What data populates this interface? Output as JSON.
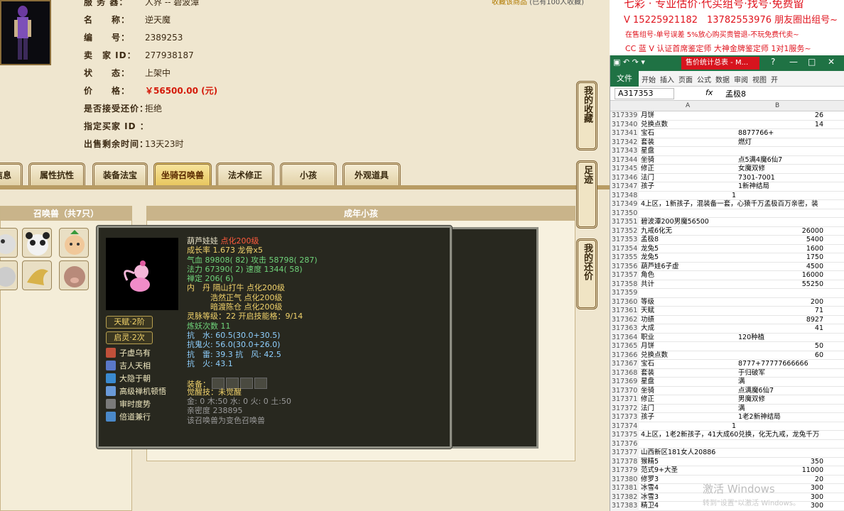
{
  "game": {
    "fav_link": "收藏该商品",
    "fav_count": "(已有100人收藏)",
    "info": [
      {
        "label": "服 务 器：",
        "value": "人界 -- 碧波潭"
      },
      {
        "label": "名　　称：",
        "value": "逆天魔"
      },
      {
        "label": "编　　号：",
        "value": "2389253"
      },
      {
        "label": "卖　家 ID：",
        "value": "277938187"
      },
      {
        "label": "状　　态：",
        "value": "上架中"
      },
      {
        "label": "价　　格：",
        "value": "￥56500.00 (元)"
      },
      {
        "label": "是否接受还价：",
        "value": "拒绝"
      },
      {
        "label": "指定买家 ID ：",
        "value": ""
      },
      {
        "label": "出售剩余时间：",
        "value": "13天23时"
      }
    ],
    "tabs": [
      "信息",
      "属性抗性",
      "装备法宝",
      "坐骑召唤兽",
      "法术修正",
      "小孩",
      "外观道具"
    ],
    "active_tab": "坐骑召唤兽",
    "summon_title": "召唤兽（共7只）",
    "adult_title": "成年小孩",
    "side_buttons": [
      "我的收藏",
      "足迹",
      "我的还价"
    ]
  },
  "tooltip": {
    "name": "葫芦娃娃",
    "name_suffix": "点化200级",
    "lines": [
      {
        "text": "成长率 1.673 龙骨x5",
        "cls": "y"
      },
      {
        "text": "气血 89808( 82) 攻击 58798( 287)",
        "cls": "g"
      },
      {
        "text": "法力 67390( 2) 速度 1344( 58)",
        "cls": "g"
      },
      {
        "text": "禅定 206( 6)",
        "cls": "g"
      },
      {
        "text": "内　丹 隔山打牛 点化200级",
        "cls": "y"
      },
      {
        "text": "　　　浩然正气 点化200级",
        "cls": "y"
      },
      {
        "text": "　　　暗渡陈仓 点化200级",
        "cls": "y"
      },
      {
        "text": "灵脉等级：22 开启技能格：9/14",
        "cls": "y"
      },
      {
        "text": "炼妖次数 11",
        "cls": "g"
      },
      {
        "text": "抗　水: 60.5(30.0+30.5)",
        "cls": "b"
      },
      {
        "text": "抗鬼火: 56.0(30.0+26.0)",
        "cls": "b"
      },
      {
        "text": "抗　雷: 39.3 抗　风: 42.5",
        "cls": "b"
      },
      {
        "text": "抗　火: 43.1",
        "cls": "b"
      },
      {
        "text": "",
        "cls": "w"
      },
      {
        "text": "装备：",
        "cls": "y"
      },
      {
        "text": "觉醒技：未觉醒",
        "cls": "y"
      },
      {
        "text": "金: 0 木:50 水: 0 火: 0 土:50",
        "cls": "gr"
      },
      {
        "text": "亲密度 238895",
        "cls": "gr"
      },
      {
        "text": "该召唤兽为变色召唤兽",
        "cls": "gr"
      }
    ],
    "badges": [
      "天赋·2阶",
      "启灵·2次"
    ],
    "skills": [
      {
        "name": "子虚乌有",
        "color": "#c0503a"
      },
      {
        "name": "吉人天相",
        "color": "#5a78c8"
      },
      {
        "name": "大隐于朝",
        "color": "#3a8ad0"
      },
      {
        "name": "高级禅机顿悟",
        "color": "#6a9ad8"
      },
      {
        "name": "审时度势",
        "color": "#7a7a7a"
      },
      {
        "name": "倍道兼行",
        "color": "#4a88c8"
      }
    ]
  },
  "ad": {
    "line1": "七彩 · 专业估价·代买组号·找号·免费留",
    "line2": "V 15225921182　13782553976 朋友圈出组号~",
    "line3": "在售组号-单号误差 5%放心购买贵管退-不玩免费代卖~",
    "line4": "CC 蓝 V 认证首席鉴定师 大神金牌鉴定师 1对1服务~"
  },
  "excel": {
    "doc_name": "售价统计总表 - M...",
    "ribbon": [
      "文件",
      "开始",
      "插入",
      "页面",
      "公式",
      "数据",
      "审阅",
      "视图",
      "开"
    ],
    "name_box": "A317353",
    "formula": "孟极8",
    "col_a": "A",
    "col_b": "B",
    "rows": [
      [
        "317339",
        "月饼",
        "26"
      ],
      [
        "317340",
        "兑换点数",
        "14"
      ],
      [
        "317341",
        "宝石",
        "8877766+"
      ],
      [
        "317342",
        "套装",
        "燃灯"
      ],
      [
        "317343",
        "星盘",
        ""
      ],
      [
        "317344",
        "坐骑",
        "点5满4魔6仙7"
      ],
      [
        "317345",
        "修正",
        "女魔双修"
      ],
      [
        "317346",
        "法门",
        "7301-7001"
      ],
      [
        "317347",
        "孩子",
        "1新神结局"
      ],
      [
        "317348",
        "1",
        ""
      ],
      [
        "317349",
        "4上区，1新孩子，混装备一套，心猿千万孟极百万亲密，装",
        ""
      ],
      [
        "317350",
        "",
        ""
      ],
      [
        "317351",
        "碧波潭200男魔56500",
        ""
      ],
      [
        "317352",
        "九戒6化无",
        "26000"
      ],
      [
        "317353",
        "孟极8",
        "5400"
      ],
      [
        "317354",
        "龙兔5",
        "1600"
      ],
      [
        "317355",
        "龙兔5",
        "1750"
      ],
      [
        "317356",
        "葫芦娃6子虚",
        "4500"
      ],
      [
        "317357",
        "角色",
        "16000"
      ],
      [
        "317358",
        "共计",
        "55250"
      ],
      [
        "317359",
        "",
        ""
      ],
      [
        "317360",
        "等级",
        "200"
      ],
      [
        "317361",
        "天赋",
        "71"
      ],
      [
        "317362",
        "功绩",
        "8927"
      ],
      [
        "317363",
        "大成",
        "41"
      ],
      [
        "317364",
        "职业",
        "120种植"
      ],
      [
        "317365",
        "月饼",
        "50"
      ],
      [
        "317366",
        "兑换点数",
        "60"
      ],
      [
        "317367",
        "宝石",
        "8777+77777666666"
      ],
      [
        "317368",
        "套装",
        "于归破军"
      ],
      [
        "317369",
        "星盘",
        "满"
      ],
      [
        "317370",
        "坐骑",
        "点满魔6仙7"
      ],
      [
        "317371",
        "修正",
        "男魔双修"
      ],
      [
        "317372",
        "法门",
        "满"
      ],
      [
        "317373",
        "孩子",
        "1老2新神结局"
      ],
      [
        "317374",
        "1",
        ""
      ],
      [
        "317375",
        "4上区，1老2新孩子，41大成60兑换，化无九戒，龙兔千万",
        ""
      ],
      [
        "317376",
        "",
        ""
      ],
      [
        "317377",
        "山西新区181女人20886",
        ""
      ],
      [
        "317378",
        "猴精5",
        "350"
      ],
      [
        "317379",
        "范式9+大圣",
        "11000"
      ],
      [
        "317380",
        "修罗3",
        "20"
      ],
      [
        "317381",
        "冰雪4",
        "300"
      ],
      [
        "317382",
        "冰雪3",
        "300"
      ],
      [
        "317383",
        "精卫4",
        "300"
      ]
    ],
    "watermark1": "激活 Windows",
    "watermark2": "转到\"设置\"以激活 Windows。"
  }
}
